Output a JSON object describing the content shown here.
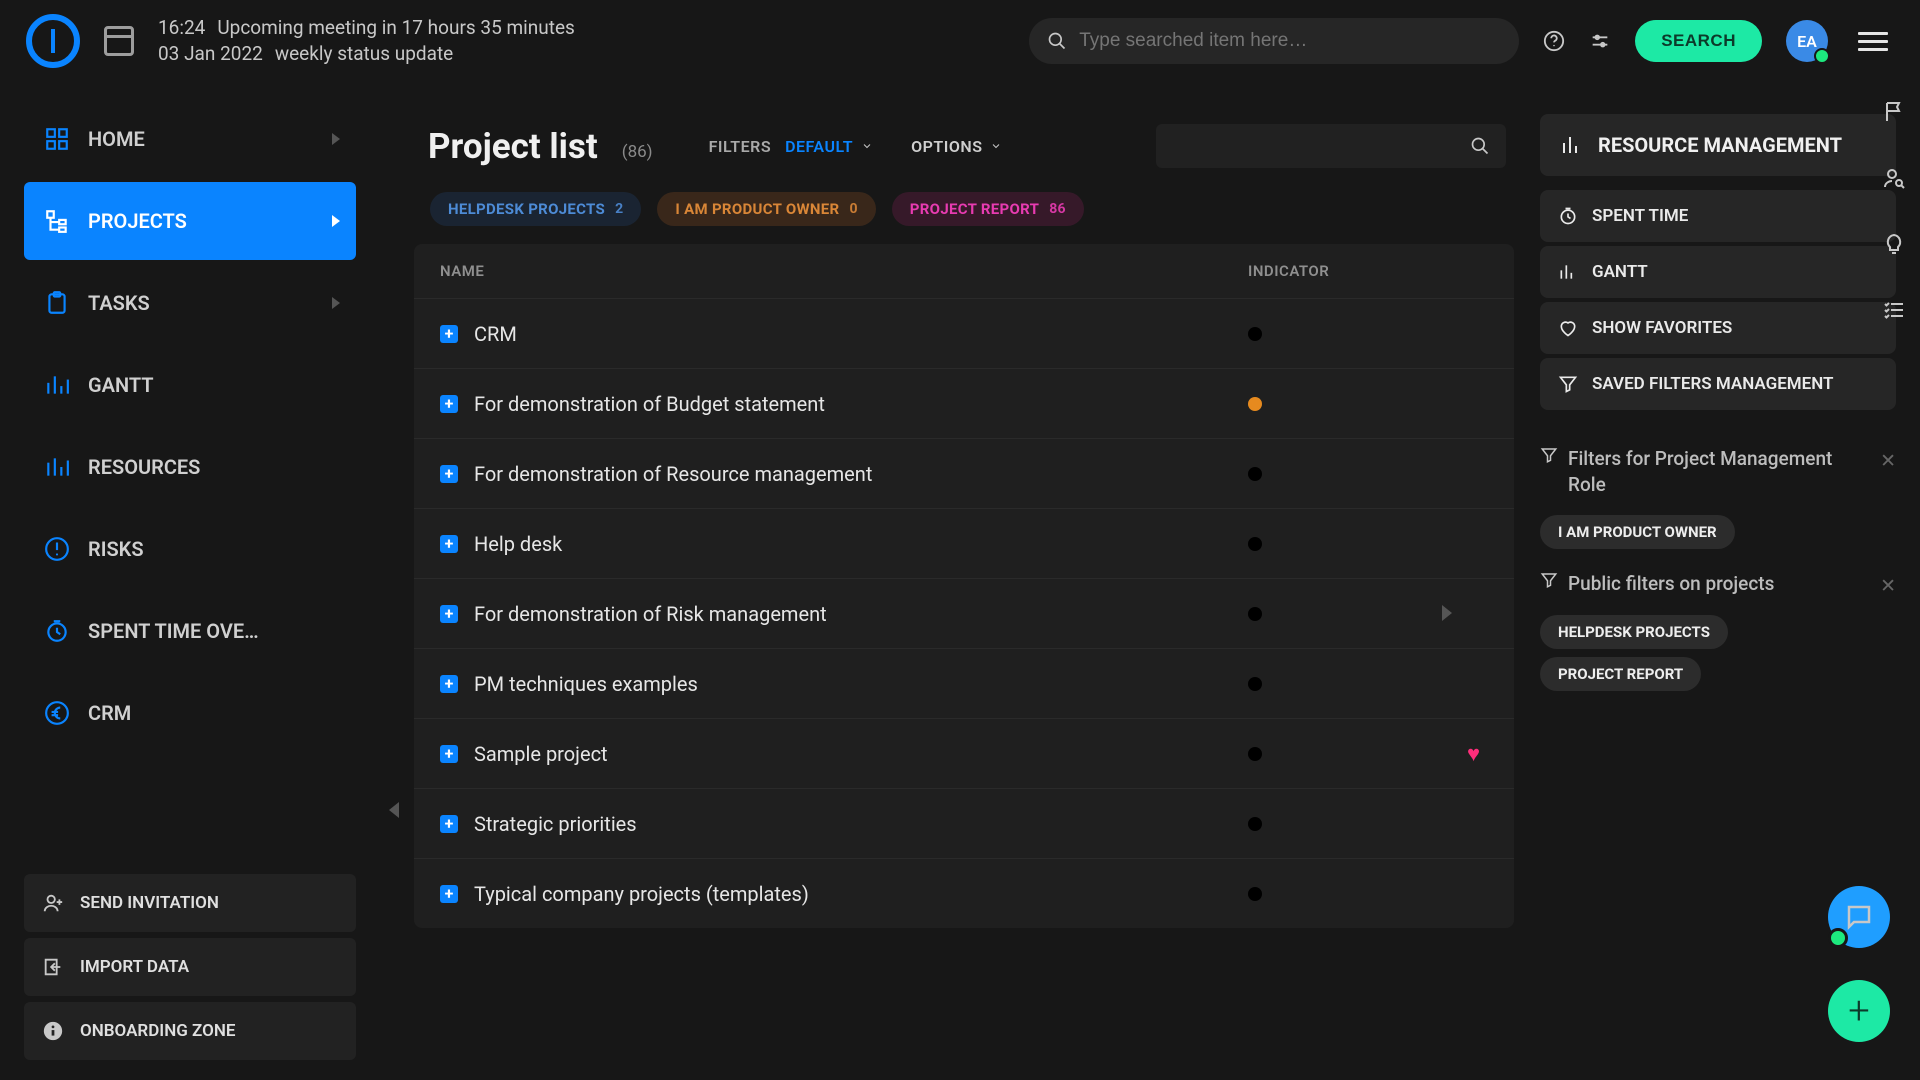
{
  "topbar": {
    "time": "16:24",
    "date": "03 Jan 2022",
    "upcoming_label": "Upcoming meeting in 17 hours 35 minutes",
    "upcoming_title": "weekly status update",
    "search_placeholder": "Type searched item here…",
    "search_button": "SEARCH",
    "avatar_initials": "EA"
  },
  "sidebar": {
    "items": [
      {
        "label": "HOME",
        "icon": "grid-icon",
        "has_chev": true
      },
      {
        "label": "PROJECTS",
        "icon": "tree-icon",
        "has_chev": true,
        "active": true
      },
      {
        "label": "TASKS",
        "icon": "clipboard-icon",
        "has_chev": true
      },
      {
        "label": "GANTT",
        "icon": "bars-icon",
        "has_chev": false
      },
      {
        "label": "RESOURCES",
        "icon": "bars-icon",
        "has_chev": false
      },
      {
        "label": "RISKS",
        "icon": "alert-icon",
        "has_chev": false
      },
      {
        "label": "SPENT TIME OVE…",
        "icon": "clock-icon",
        "has_chev": false
      },
      {
        "label": "CRM",
        "icon": "euro-icon",
        "has_chev": false
      }
    ],
    "actions": {
      "invite": "SEND INVITATION",
      "import": "IMPORT DATA",
      "onboarding": "ONBOARDING ZONE"
    }
  },
  "page": {
    "heading": "Project list",
    "count_display": "(86)",
    "filters_label": "FILTERS",
    "filters_value": "DEFAULT",
    "options_label": "OPTIONS"
  },
  "chips": [
    {
      "label": "HELPDESK PROJECTS",
      "count": "2",
      "variant": "blue"
    },
    {
      "label": "I AM PRODUCT OWNER",
      "count": "0",
      "variant": "orange"
    },
    {
      "label": "PROJECT REPORT",
      "count": "86",
      "variant": "pink"
    }
  ],
  "table": {
    "columns": {
      "name": "NAME",
      "indicator": "INDICATOR"
    },
    "rows": [
      {
        "name": "CRM",
        "indicator": "black",
        "favorite": false
      },
      {
        "name": "For demonstration of Budget statement",
        "indicator": "orange",
        "favorite": false
      },
      {
        "name": "For demonstration of Resource management",
        "indicator": "black",
        "favorite": false
      },
      {
        "name": "Help desk",
        "indicator": "black",
        "favorite": false
      },
      {
        "name": "For demonstration of Risk management",
        "indicator": "black",
        "favorite": false
      },
      {
        "name": "PM techniques examples",
        "indicator": "black",
        "favorite": false
      },
      {
        "name": "Sample project",
        "indicator": "black",
        "favorite": true
      },
      {
        "name": "Strategic priorities",
        "indicator": "black",
        "favorite": false
      },
      {
        "name": "Typical company projects (templates)",
        "indicator": "black",
        "favorite": false
      }
    ]
  },
  "rightpanel": {
    "header": "RESOURCE MANAGEMENT",
    "items": [
      {
        "label": "SPENT TIME",
        "icon": "clock-icon"
      },
      {
        "label": "GANTT",
        "icon": "bars-icon"
      },
      {
        "label": "SHOW FAVORITES",
        "icon": "heart-icon"
      },
      {
        "label": "SAVED FILTERS MANAGEMENT",
        "icon": "funnel-icon"
      }
    ],
    "groups": [
      {
        "title": "Filters for Project Management Role",
        "chips": [
          "I AM PRODUCT OWNER"
        ]
      },
      {
        "title": "Public filters on projects",
        "chips": [
          "HELPDESK PROJECTS",
          "PROJECT REPORT"
        ]
      }
    ]
  }
}
